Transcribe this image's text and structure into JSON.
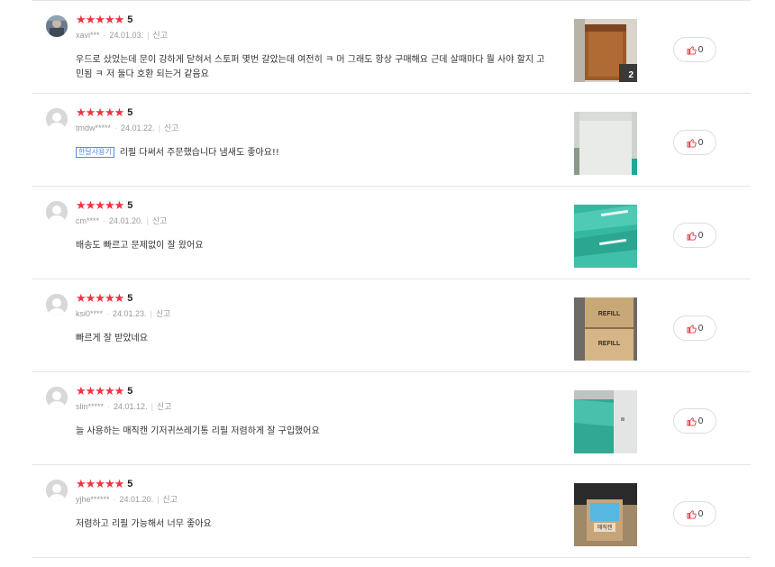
{
  "reviews": [
    {
      "stars": "★★★★★",
      "rating": "5",
      "user": "xavi***",
      "date": "24.01.03.",
      "report": "신고",
      "tag": "",
      "text": "우드로 샀었는데 문이 강하게 닫혀서 스토퍼 몇번 갈았는데 여전히 ㅋ 머 그래도 항상 구매해요 근데 살때마다 뭘 사야 할지 고민됨 ㅋ 저 둘다 호환 되는거 같음요",
      "photo_count": "2",
      "likes": "0",
      "avatar": "photo"
    },
    {
      "stars": "★★★★★",
      "rating": "5",
      "user": "tmdw*****",
      "date": "24.01.22.",
      "report": "신고",
      "tag": "한달사용기",
      "text": "리필 다써서 주문했습니다 냄새도 좋아요!!",
      "photo_count": "",
      "likes": "0",
      "avatar": "default"
    },
    {
      "stars": "★★★★★",
      "rating": "5",
      "user": "cm****",
      "date": "24.01.20.",
      "report": "신고",
      "tag": "",
      "text": "배송도 빠르고 문제없이 잘 왔어요",
      "photo_count": "",
      "likes": "0",
      "avatar": "default"
    },
    {
      "stars": "★★★★★",
      "rating": "5",
      "user": "ksi0****",
      "date": "24.01.23.",
      "report": "신고",
      "tag": "",
      "text": "빠르게 잘 받았네요",
      "photo_count": "",
      "likes": "0",
      "avatar": "default",
      "photo_labels": [
        "REFILL",
        "REFILL"
      ]
    },
    {
      "stars": "★★★★★",
      "rating": "5",
      "user": "slin*****",
      "date": "24.01.12.",
      "report": "신고",
      "tag": "",
      "text": "늘 사용하는 매직캔 기저귀쓰레기통 리필 저렴하게 잘 구입했어요",
      "photo_count": "",
      "likes": "0",
      "avatar": "default"
    },
    {
      "stars": "★★★★★",
      "rating": "5",
      "user": "yjhe******",
      "date": "24.01.20.",
      "report": "신고",
      "tag": "",
      "text": "저렴하고 리필 가능해서 너무 좋아요",
      "photo_count": "",
      "likes": "0",
      "avatar": "default",
      "photo_labels": [
        "매직캔"
      ]
    }
  ],
  "colors": {
    "star": "#ef3340",
    "tag": "#4a90e2",
    "like_icon": "#ef3340"
  }
}
